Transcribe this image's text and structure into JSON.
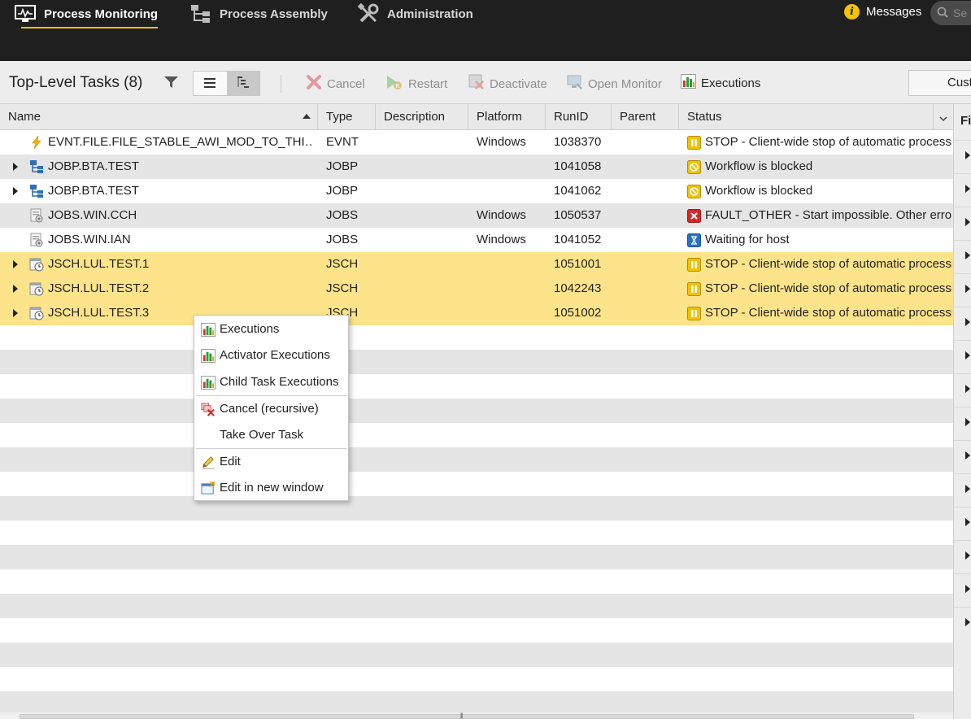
{
  "nav": {
    "items": [
      {
        "label": "Process Monitoring",
        "icon": "monitor-icon",
        "active": true
      },
      {
        "label": "Process Assembly",
        "icon": "tree-icon",
        "active": false
      },
      {
        "label": "Administration",
        "icon": "tools-icon",
        "active": false
      }
    ],
    "messages_label": "Messages",
    "search_placeholder": "Se"
  },
  "toolbar": {
    "title": "Top-Level Tasks (8)",
    "buttons": [
      {
        "label": "Cancel",
        "icon": "cancel-icon",
        "enabled": false
      },
      {
        "label": "Restart",
        "icon": "restart-icon",
        "enabled": false
      },
      {
        "label": "Deactivate",
        "icon": "deactivate-icon",
        "enabled": false
      },
      {
        "label": "Open Monitor",
        "icon": "monitor-icon",
        "enabled": false
      },
      {
        "label": "Executions",
        "icon": "bar-chart-icon",
        "enabled": true
      }
    ],
    "custom_label": "Cust"
  },
  "grid": {
    "columns": [
      "Name",
      "Type",
      "Description",
      "Platform",
      "RunID",
      "Parent",
      "Status"
    ],
    "rows": [
      {
        "name": "EVNT.FILE.FILE_STABLE_AWI_MOD_TO_THI…",
        "type": "EVNT",
        "description": "",
        "platform": "Windows",
        "runid": "1038370",
        "parent": "",
        "status": "STOP - Client-wide stop of automatic processi",
        "status_icon": "pause",
        "task_icon": "event",
        "expandable": false,
        "highlight": false
      },
      {
        "name": "JOBP.BTA.TEST",
        "type": "JOBP",
        "description": "",
        "platform": "",
        "runid": "1041058",
        "parent": "",
        "status": "Workflow is blocked",
        "status_icon": "blocked",
        "task_icon": "workflow",
        "expandable": true,
        "highlight": false
      },
      {
        "name": "JOBP.BTA.TEST",
        "type": "JOBP",
        "description": "",
        "platform": "",
        "runid": "1041062",
        "parent": "",
        "status": "Workflow is blocked",
        "status_icon": "blocked",
        "task_icon": "workflow",
        "expandable": true,
        "highlight": false
      },
      {
        "name": "JOBS.WIN.CCH",
        "type": "JOBS",
        "description": "",
        "platform": "Windows",
        "runid": "1050537",
        "parent": "",
        "status": "FAULT_OTHER - Start impossible. Other error.",
        "status_icon": "error",
        "task_icon": "job",
        "expandable": false,
        "highlight": false
      },
      {
        "name": "JOBS.WIN.IAN",
        "type": "JOBS",
        "description": "",
        "platform": "Windows",
        "runid": "1041052",
        "parent": "",
        "status": "Waiting for host",
        "status_icon": "waiting",
        "task_icon": "job",
        "expandable": false,
        "highlight": false
      },
      {
        "name": "JSCH.LUL.TEST.1",
        "type": "JSCH",
        "description": "",
        "platform": "",
        "runid": "1051001",
        "parent": "",
        "status": "STOP - Client-wide stop of automatic processi",
        "status_icon": "pause",
        "task_icon": "schedule",
        "expandable": true,
        "highlight": true
      },
      {
        "name": "JSCH.LUL.TEST.2",
        "type": "JSCH",
        "description": "",
        "platform": "",
        "runid": "1042243",
        "parent": "",
        "status": "STOP - Client-wide stop of automatic processi",
        "status_icon": "pause",
        "task_icon": "schedule",
        "expandable": true,
        "highlight": true
      },
      {
        "name": "JSCH.LUL.TEST.3",
        "type": "JSCH",
        "description": "",
        "platform": "",
        "runid": "1051002",
        "parent": "",
        "status": "STOP - Client-wide stop of automatic processi",
        "status_icon": "pause",
        "task_icon": "schedule",
        "expandable": true,
        "highlight": true
      }
    ]
  },
  "right_panel": {
    "header": "Fi"
  },
  "context_menu": {
    "items": [
      {
        "label": "Executions",
        "icon": "bar-chart-icon"
      },
      {
        "label": "Activator Executions",
        "icon": "bar-chart-icon"
      },
      {
        "label": "Child Task Executions",
        "icon": "bar-chart-icon"
      },
      {
        "label": "Cancel (recursive)",
        "icon": "cancel-recursive-icon"
      },
      {
        "label": "Take Over Task",
        "icon": ""
      },
      {
        "label": "Edit",
        "icon": "pencil-icon"
      },
      {
        "label": "Edit in new window",
        "icon": "new-window-icon"
      }
    ]
  },
  "colors": {
    "topbar": "#1f1f1f",
    "accent": "#f5c400",
    "highlight_row": "#fde48a",
    "alt_row": "#e5e5e5"
  }
}
